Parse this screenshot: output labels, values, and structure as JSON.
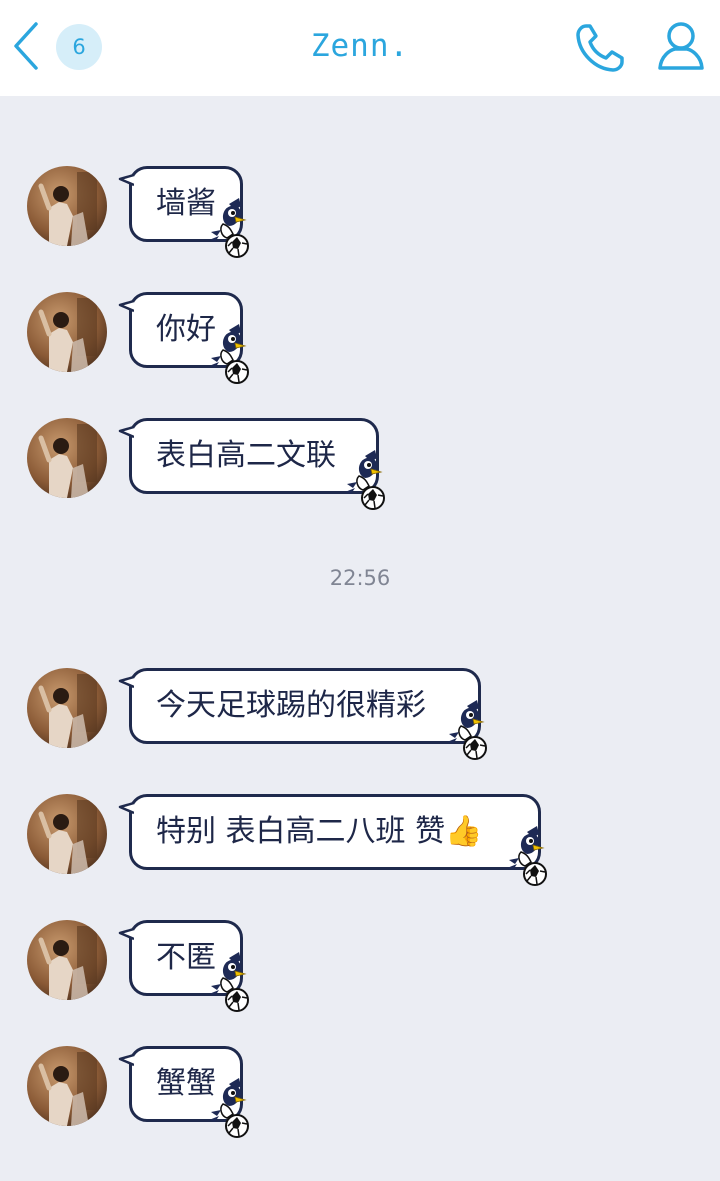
{
  "header": {
    "back_icon": "chevron-left-icon",
    "unread_count": "6",
    "title": "Zenn.",
    "call_icon": "phone-icon",
    "profile_icon": "person-icon",
    "accent_color": "#2BA6DE"
  },
  "chat": {
    "messages": [
      {
        "text": "墙酱"
      },
      {
        "text": "你好"
      },
      {
        "text": "表白高二文联"
      },
      {
        "text": "今天足球踢的很精彩"
      },
      {
        "text": "特别 表白高二八班 赞",
        "emoji": "👍"
      },
      {
        "text": "不匿"
      },
      {
        "text": "蟹蟹"
      }
    ],
    "timestamp": "22:56",
    "bubble_border_color": "#1F2A4D",
    "background_color": "#EBEDF3"
  }
}
